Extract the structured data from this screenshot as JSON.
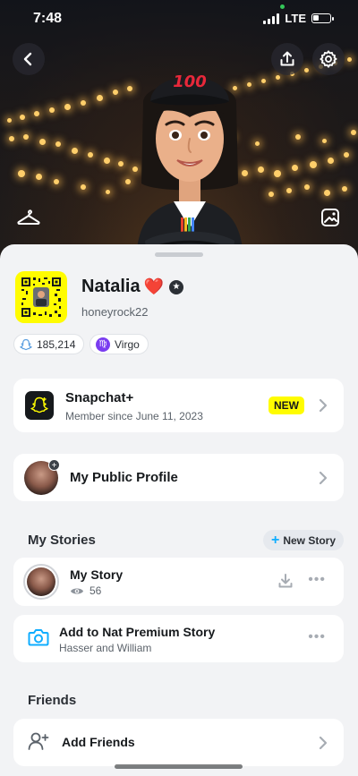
{
  "status_bar": {
    "time": "7:48",
    "network": "LTE"
  },
  "hero": {
    "back_icon": "chevron-left-icon",
    "share_icon": "share-upload-icon",
    "settings_icon": "gear-icon",
    "hanger_icon": "hanger-icon",
    "image_icon": "image-icon",
    "bitmoji_cap_text": "100"
  },
  "profile": {
    "display_name": "Natalia",
    "heart": "❤️",
    "username": "honeyrock22",
    "score": "185,214",
    "zodiac": "Virgo",
    "zodiac_symbol": "♍"
  },
  "snapchat_plus": {
    "title": "Snapchat+",
    "subtitle": "Member since June 11, 2023",
    "badge": "NEW",
    "badge_color": "#fffc00"
  },
  "public_profile": {
    "label": "My Public Profile"
  },
  "stories": {
    "section_title": "My Stories",
    "new_story_label": "New Story",
    "my_story": {
      "title": "My Story",
      "views": "56"
    },
    "premium_story": {
      "title": "Add to Nat Premium Story",
      "subtitle": "Hasser and William"
    }
  },
  "friends": {
    "section_title": "Friends",
    "add_friends_label": "Add Friends"
  },
  "colors": {
    "accent_blue": "#0fadff",
    "snap_yellow": "#fffc00",
    "zodiac_purple": "#7a3df0"
  }
}
